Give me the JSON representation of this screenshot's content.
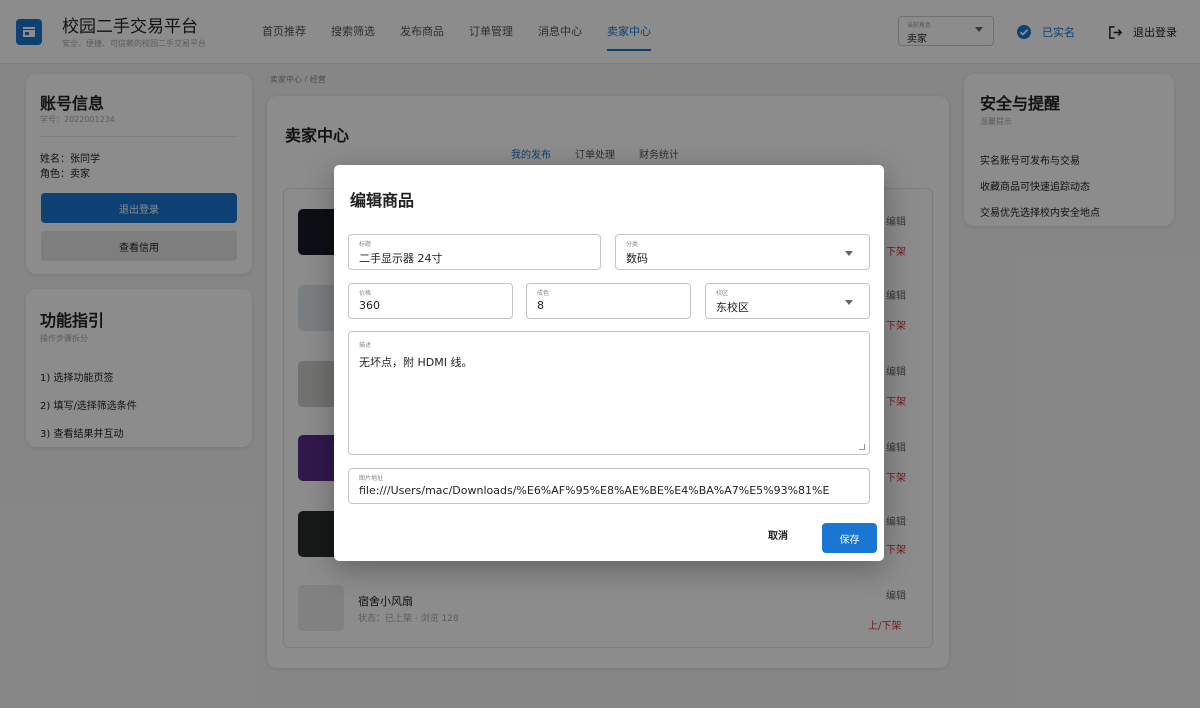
{
  "header": {
    "brand_title": "校园二手交易平台",
    "brand_subtitle": "安全、便捷、可信赖的校园二手交易平台",
    "nav": [
      "首页推荐",
      "搜索筛选",
      "发布商品",
      "订单管理",
      "消息中心",
      "卖家中心"
    ],
    "active_nav": "卖家中心",
    "role_label": "当前角色",
    "role_value": "卖家",
    "verified_label": "已实名",
    "logout_label": "退出登录"
  },
  "account": {
    "title": "账号信息",
    "student_id": "学号：2022001234",
    "name": "姓名：张同学",
    "role": "角色：卖家",
    "logout_button": "退出登录",
    "credit_button": "查看信用"
  },
  "guide": {
    "title": "功能指引",
    "subtitle": "操作步骤拆分",
    "steps": [
      "1) 选择功能页签",
      "2) 填写/选择筛选条件",
      "3) 查看结果并互动"
    ]
  },
  "safety": {
    "title": "安全与提醒",
    "subtitle": "温馨提示",
    "tips": [
      "实名账号可发布与交易",
      "收藏商品可快速追踪动态",
      "交易优先选择校内安全地点"
    ]
  },
  "breadcrumb": "卖家中心 / 经营",
  "seller": {
    "title": "卖家中心",
    "tabs": [
      "我的发布",
      "订单处理",
      "财务统计"
    ],
    "active_tab": "我的发布",
    "edit_label": "编辑",
    "toggle_label_partial": "下架",
    "toggle_label": "上/下架",
    "last_item_title": "宿舍小风扇",
    "last_item_meta": "状态：已上架 · 浏览 128"
  },
  "modal": {
    "title": "编辑商品",
    "fields": {
      "title_label": "标题",
      "title_value": "二手显示器 24寸",
      "category_label": "分类",
      "category_value": "数码",
      "price_label": "价格",
      "price_value": "360",
      "condition_label": "成色",
      "condition_value": "8",
      "campus_label": "校区",
      "campus_value": "东校区",
      "desc_label": "描述",
      "desc_value": "无坏点，附 HDMI 线。",
      "image_label": "图片地址",
      "image_value": "file:///Users/mac/Downloads/%E6%AF%95%E8%AE%BE%E4%BA%A7%E5%93%81%E"
    },
    "cancel_label": "取消",
    "save_label": "保存"
  },
  "colors": {
    "primary": "#1976d2",
    "danger": "#d32f2f"
  }
}
